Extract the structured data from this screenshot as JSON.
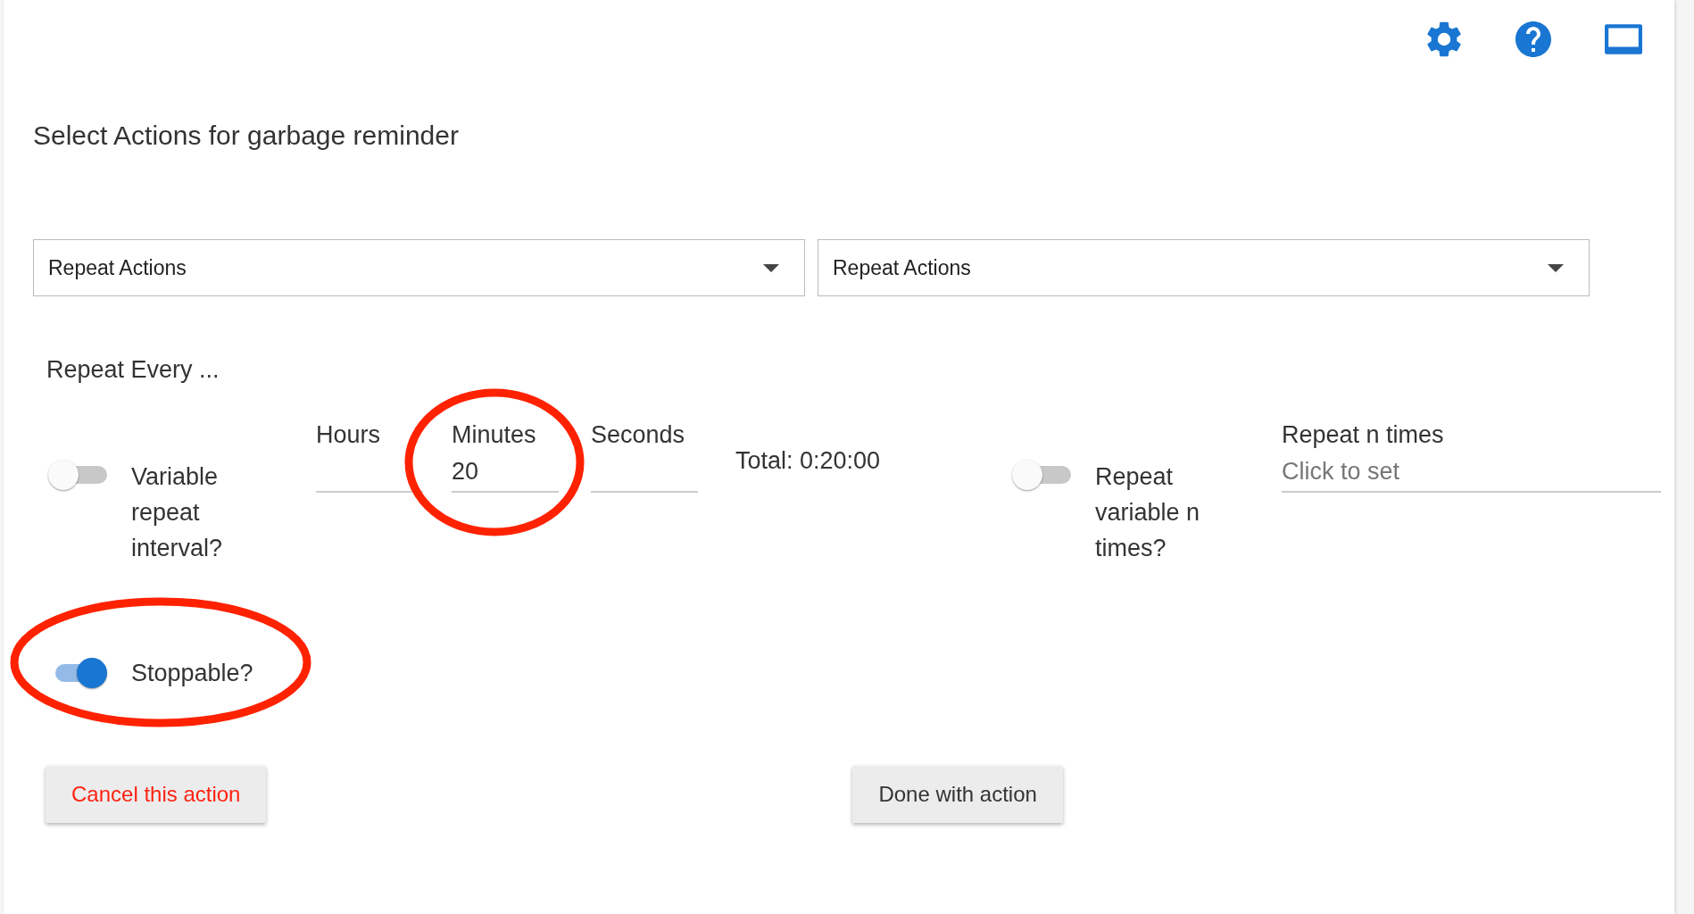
{
  "toolbar": {
    "icons": [
      {
        "kind": "settings"
      },
      {
        "kind": "help"
      },
      {
        "kind": "screen"
      }
    ]
  },
  "title": "Select Actions for garbage reminder",
  "dropdowns": [
    {
      "value": "Repeat Actions"
    },
    {
      "value": "Repeat Actions"
    }
  ],
  "section_label": "Repeat Every ...",
  "variable_interval": {
    "label": "Variable repeat interval?",
    "on": false
  },
  "time_fields": [
    {
      "label": "Hours"
    },
    {
      "label": "Minutes",
      "value": "20"
    },
    {
      "label": "Seconds"
    }
  ],
  "total": "Total: 0:20:00",
  "variable_n": {
    "label": "Repeat variable n times?",
    "on": false
  },
  "repeat_n": {
    "label": "Repeat n times",
    "placeholder": "Click to set"
  },
  "stoppable": {
    "label": "Stoppable?",
    "on": true
  },
  "buttons": [
    {
      "label": "Cancel this action",
      "kind": "cancel"
    },
    {
      "label": "Done with action",
      "kind": "done"
    }
  ]
}
